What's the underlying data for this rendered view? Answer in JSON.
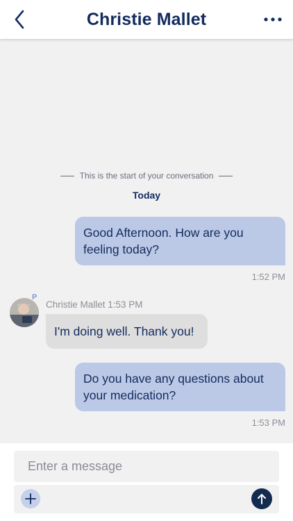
{
  "header": {
    "title": "Christie Mallet",
    "back_icon": "chevron-left-icon",
    "more_icon": "more-horizontal-icon"
  },
  "conversation": {
    "start_text": "This is the start of your conversation",
    "day_label": "Today",
    "messages": [
      {
        "direction": "outgoing",
        "text": "Good Afternoon. How are you feeling today?",
        "time": "1:52 PM"
      },
      {
        "direction": "incoming",
        "sender": "Christie Mallet 1:53 PM",
        "badge": "P",
        "text": "I'm doing well. Thank you!"
      },
      {
        "direction": "outgoing",
        "text": "Do you have any questions about your medication?",
        "time": "1:53 PM"
      }
    ]
  },
  "composer": {
    "placeholder": "Enter a message",
    "value": "",
    "add_icon": "plus-icon",
    "send_icon": "arrow-up-icon"
  },
  "colors": {
    "brand_navy": "#132b5e",
    "outgoing_bubble": "#bcc9e6",
    "incoming_bubble": "#dedede",
    "background": "#f1f1f2"
  }
}
